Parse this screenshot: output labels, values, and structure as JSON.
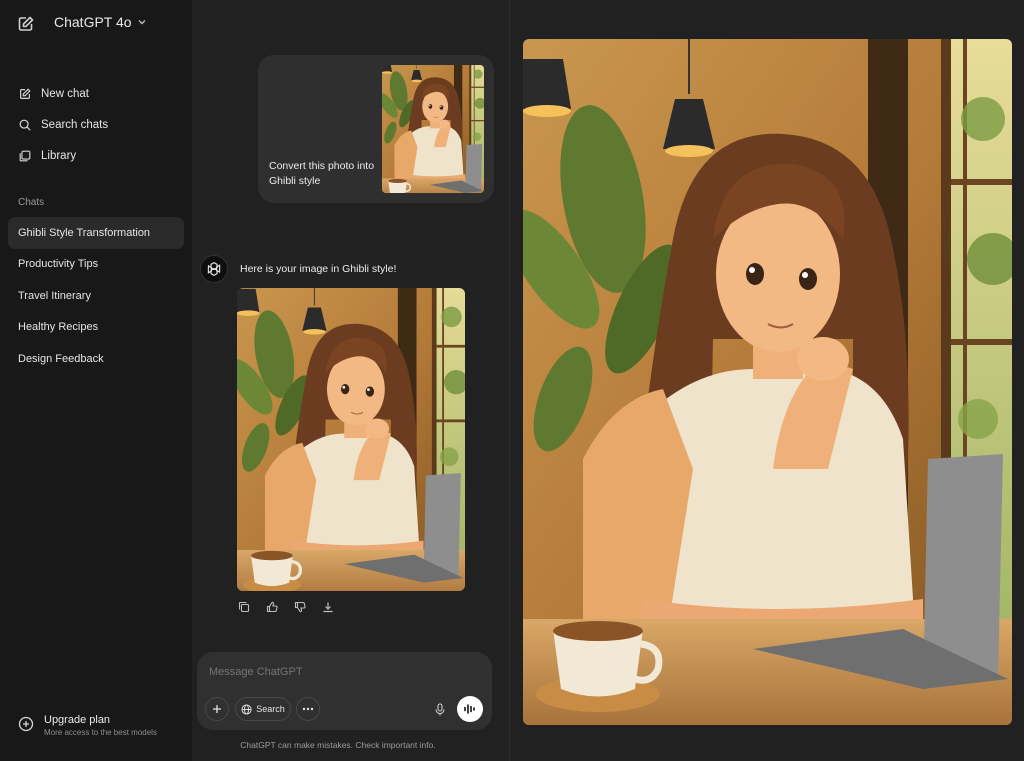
{
  "header": {
    "model_name": "ChatGPT 4o"
  },
  "sidebar": {
    "nav": [
      {
        "label": "New chat",
        "icon": "new-chat-icon"
      },
      {
        "label": "Search chats",
        "icon": "search-icon"
      },
      {
        "label": "Library",
        "icon": "library-icon"
      }
    ],
    "chats_heading": "Chats",
    "chats": [
      "Ghibli Style Transformation",
      "Productivity Tips",
      "Travel Itinerary",
      "Healthy Recipes",
      "Design Feedback"
    ],
    "upgrade": {
      "title": "Upgrade plan",
      "subtitle": "More access to the best models"
    }
  },
  "conversation": {
    "user_message": "Convert this photo into Ghibli style",
    "assistant_message": "Here is your image in Ghibli style!"
  },
  "composer": {
    "placeholder": "Message ChatGPT",
    "search_label": "Search"
  },
  "disclaimer": "ChatGPT can make mistakes. Check important info.",
  "colors": {
    "sidebar_bg": "#181818",
    "main_bg": "#212121",
    "bubble_bg": "#2f2f2f",
    "active_chat_bg": "#2a2a2a"
  }
}
